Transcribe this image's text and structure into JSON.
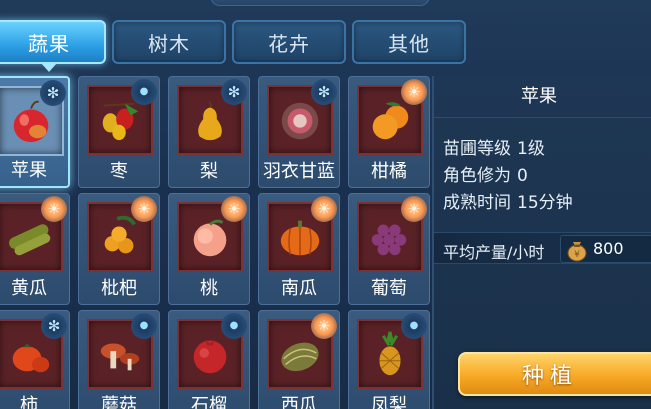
{
  "tabs": [
    {
      "label": "蔬果",
      "active": true
    },
    {
      "label": "树木",
      "active": false
    },
    {
      "label": "花卉",
      "active": false
    },
    {
      "label": "其他",
      "active": false
    }
  ],
  "items": [
    {
      "name": "苹果",
      "badge": "snow",
      "selected": true,
      "icon": "apple-icon"
    },
    {
      "name": "枣",
      "badge": "drop",
      "icon": "jujube-icon"
    },
    {
      "name": "梨",
      "badge": "snow",
      "icon": "pear-icon"
    },
    {
      "name": "羽衣甘蓝",
      "badge": "snow",
      "icon": "kale-icon"
    },
    {
      "name": "柑橘",
      "badge": "sun",
      "icon": "orange-icon"
    },
    {
      "name": "黄瓜",
      "badge": "sun",
      "icon": "cucumber-icon"
    },
    {
      "name": "枇杷",
      "badge": "sun",
      "icon": "loquat-icon"
    },
    {
      "name": "桃",
      "badge": "sun",
      "icon": "peach-icon"
    },
    {
      "name": "南瓜",
      "badge": "sun",
      "icon": "pumpkin-icon"
    },
    {
      "name": "葡萄",
      "badge": "sun",
      "icon": "grape-icon"
    },
    {
      "name": "柿",
      "badge": "snow",
      "icon": "persimmon-icon"
    },
    {
      "name": "蘑菇",
      "badge": "drop",
      "icon": "mushroom-icon"
    },
    {
      "name": "石榴",
      "badge": "drop",
      "icon": "pomegranate-icon"
    },
    {
      "name": "西瓜",
      "badge": "sun",
      "icon": "melon-icon"
    },
    {
      "name": "凤梨",
      "badge": "drop",
      "icon": "pineapple-icon"
    }
  ],
  "detail": {
    "title": "苹果",
    "nursery_label": "苗圃等级",
    "nursery_value": "1级",
    "cultivation_label": "角色修为",
    "cultivation_value": "0",
    "mature_label": "成熟时间",
    "mature_value": "15分钟",
    "yield_label": "平均产量/小时",
    "yield_value": "800"
  },
  "plant_button": "种植",
  "colors": {
    "accent": "#2c9fe4",
    "button": "#f7a925"
  }
}
